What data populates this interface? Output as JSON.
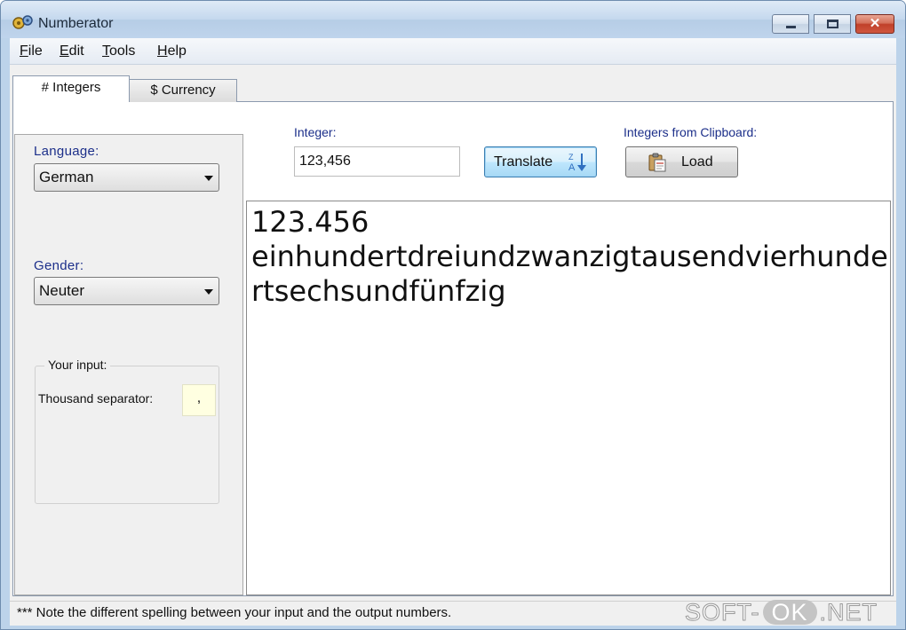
{
  "window": {
    "title": "Numberator",
    "app_icon": "gears-icon",
    "close_glyph": "✕"
  },
  "menu": {
    "items": [
      {
        "mnemonic": "F",
        "rest": "ile"
      },
      {
        "mnemonic": "E",
        "rest": "dit"
      },
      {
        "mnemonic": "T",
        "rest": "ools"
      },
      {
        "mnemonic": "H",
        "rest": "elp"
      }
    ]
  },
  "tabs": [
    {
      "label": "# Integers",
      "active": true
    },
    {
      "label": "$ Currency",
      "active": false
    }
  ],
  "settings": {
    "language_label": "Language:",
    "language_value": "German",
    "gender_label": "Gender:",
    "gender_value": "Neuter",
    "group_title": "Your input:",
    "thousand_separator_label": "Thousand separator:",
    "thousand_separator_value": ","
  },
  "controls": {
    "integer_label": "Integer:",
    "integer_value": "123,456",
    "translate_label": "Translate",
    "clipboard_label": "Integers from Clipboard:",
    "load_label": "Load"
  },
  "output": {
    "number": "123.456",
    "words": "einhundertdreiundzwanzigtausendvierhundertsechsundfünfzig"
  },
  "status": {
    "text": "*** Note the different spelling between your input and the output numbers."
  },
  "watermark": {
    "left": "SOFT-",
    "mid": "OK",
    "right": ".NET"
  },
  "colors": {
    "label_blue": "#1c2f8a",
    "translate_border": "#3c7fb1",
    "separator_bg": "#ffffe1"
  }
}
